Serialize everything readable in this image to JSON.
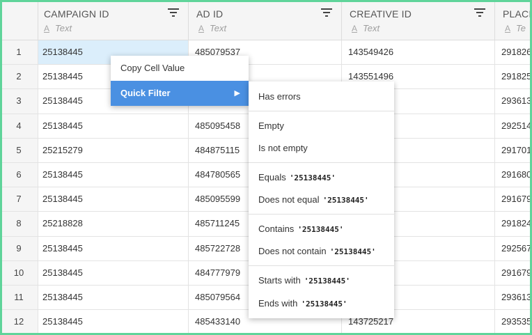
{
  "columns": [
    {
      "title": "CAMPAIGN ID",
      "type_label": "Text"
    },
    {
      "title": "AD ID",
      "type_label": "Text"
    },
    {
      "title": "CREATIVE ID",
      "type_label": "Text"
    },
    {
      "title": "PLACI",
      "type_label": "Te"
    }
  ],
  "rows": [
    {
      "num": "1",
      "campaign": "25138445",
      "ad": "485079537",
      "creative": "143549426",
      "placement": "291826"
    },
    {
      "num": "2",
      "campaign": "25138445",
      "ad": "",
      "creative": "143551496",
      "placement": "291825"
    },
    {
      "num": "3",
      "campaign": "25138445",
      "ad": "",
      "creative": "",
      "placement": "293613"
    },
    {
      "num": "4",
      "campaign": "25138445",
      "ad": "485095458",
      "creative": "",
      "placement": "292514"
    },
    {
      "num": "5",
      "campaign": "25215279",
      "ad": "484875115",
      "creative": "",
      "placement": "291701"
    },
    {
      "num": "6",
      "campaign": "25138445",
      "ad": "484780565",
      "creative": "",
      "placement": "291680"
    },
    {
      "num": "7",
      "campaign": "25138445",
      "ad": "485095599",
      "creative": "",
      "placement": "291679"
    },
    {
      "num": "8",
      "campaign": "25218828",
      "ad": "485711245",
      "creative": "",
      "placement": "291824"
    },
    {
      "num": "9",
      "campaign": "25138445",
      "ad": "485722728",
      "creative": "",
      "placement": "292567"
    },
    {
      "num": "10",
      "campaign": "25138445",
      "ad": "484777979",
      "creative": "",
      "placement": "291679"
    },
    {
      "num": "11",
      "campaign": "25138445",
      "ad": "485079564",
      "creative": "",
      "placement": "293613"
    },
    {
      "num": "12",
      "campaign": "25138445",
      "ad": "485433140",
      "creative": "143725217",
      "placement": "293535"
    }
  ],
  "context_menu": {
    "copy_label": "Copy Cell Value",
    "quick_filter_label": "Quick Filter",
    "arrow": "▶"
  },
  "quick_filter_menu": {
    "has_errors": "Has errors",
    "empty": "Empty",
    "is_not_empty": "Is not empty",
    "equals": "Equals",
    "does_not_equal": "Does not equal",
    "contains": "Contains",
    "does_not_contain": "Does not contain",
    "starts_with": "Starts with",
    "ends_with": "Ends with",
    "value": "'25138445'"
  },
  "colors": {
    "accent": "#4a90e2",
    "selection": "#dbeefb",
    "frame": "#5fd49a"
  }
}
